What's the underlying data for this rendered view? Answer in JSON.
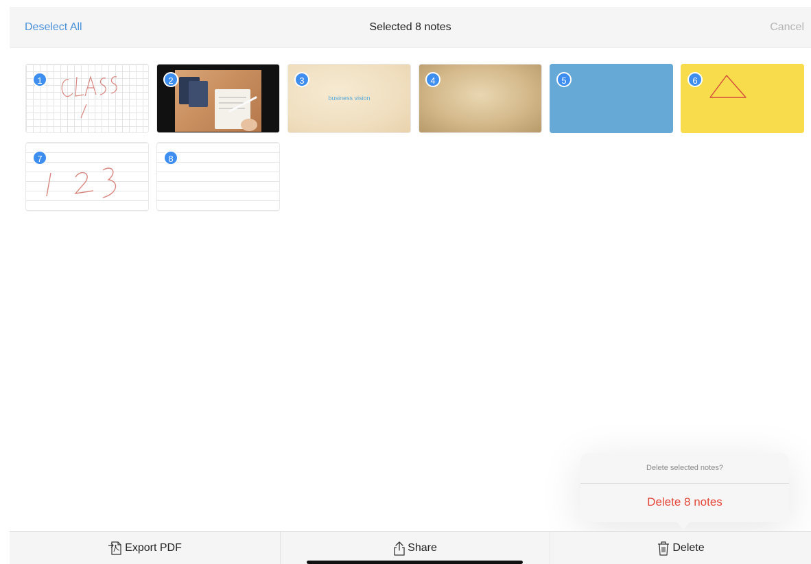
{
  "header": {
    "deselect_all": "Deselect All",
    "title": "Selected 8 notes",
    "cancel": "Cancel"
  },
  "notes": [
    {
      "number": "1",
      "background": "grid",
      "handwriting": "CLASS 1"
    },
    {
      "number": "2",
      "background": "photo"
    },
    {
      "number": "3",
      "background": "paper",
      "text": "business vision"
    },
    {
      "number": "4",
      "background": "old-paper"
    },
    {
      "number": "5",
      "background": "blue",
      "color": "#66a9d6"
    },
    {
      "number": "6",
      "background": "yellow",
      "color": "#f8dc4b"
    },
    {
      "number": "7",
      "background": "lined",
      "handwriting": "1 2 3"
    },
    {
      "number": "8",
      "background": "lined"
    }
  ],
  "delete_popover": {
    "message": "Delete selected notes?",
    "confirm_label": "Delete 8 notes",
    "confirm_color": "#e5483b"
  },
  "toolbar": {
    "export_pdf": "Export PDF",
    "share": "Share",
    "delete": "Delete"
  },
  "colors": {
    "accent": "#4a90d9",
    "badge": "#3d8ef0",
    "destructive": "#e5483b"
  }
}
